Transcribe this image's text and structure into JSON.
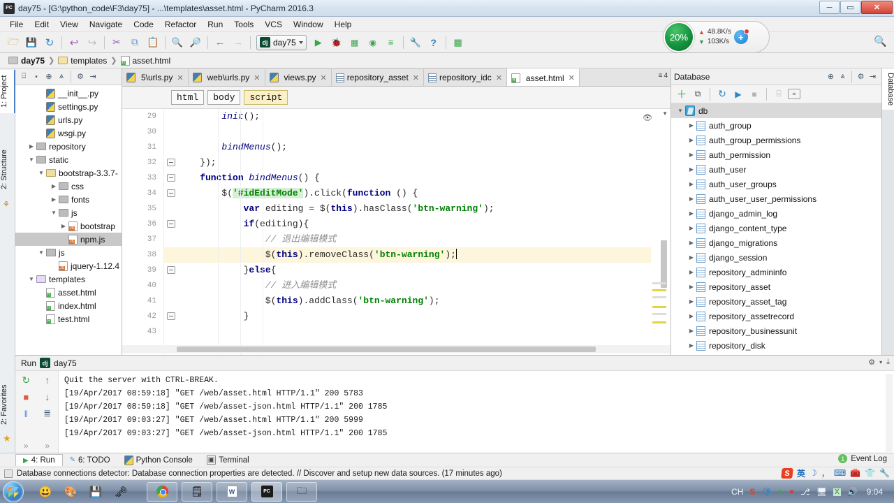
{
  "window": {
    "title": "day75 - [G:\\python_code\\F3\\day75] - ...\\templates\\asset.html - PyCharm 2016.3",
    "app_icon": "PC",
    "minimize": "─",
    "maximize": "▭",
    "close": "✕"
  },
  "menubar": [
    {
      "label": "File"
    },
    {
      "label": "Edit"
    },
    {
      "label": "View"
    },
    {
      "label": "Navigate"
    },
    {
      "label": "Code"
    },
    {
      "label": "Refactor"
    },
    {
      "label": "Run"
    },
    {
      "label": "Tools"
    },
    {
      "label": "VCS"
    },
    {
      "label": "Window"
    },
    {
      "label": "Help"
    }
  ],
  "toolbar": {
    "buttons": [
      {
        "name": "open-folder-icon",
        "glyph": "🗁",
        "color": "#d9a441"
      },
      {
        "name": "save-all-icon",
        "glyph": "💾",
        "color": "#5b7c99"
      },
      {
        "name": "sync-icon",
        "glyph": "↻",
        "color": "#2f86c5"
      },
      {
        "name": "undo-icon",
        "glyph": "↩",
        "color": "#9b59b6"
      },
      {
        "name": "redo-icon",
        "glyph": "↪",
        "color": "#b0b0b0"
      },
      {
        "name": "cut-icon",
        "glyph": "✂",
        "color": "#9b59b6"
      },
      {
        "name": "copy-icon",
        "glyph": "⧉",
        "color": "#5b9bd5"
      },
      {
        "name": "paste-icon",
        "glyph": "📋",
        "color": "#c9a227"
      },
      {
        "name": "find-icon",
        "glyph": "🔍",
        "color": "#4a7fb5"
      },
      {
        "name": "replace-icon",
        "glyph": "🔎",
        "color": "#4a7fb5"
      },
      {
        "name": "back-icon",
        "glyph": "←",
        "color": "#4a90d9"
      },
      {
        "name": "forward-icon",
        "glyph": "→",
        "color": "#b8ccdd"
      }
    ],
    "run_config": {
      "icon_label": "dj",
      "label": "day75"
    },
    "run_buttons": [
      {
        "name": "run-icon",
        "glyph": "▶",
        "color": "#3aa64c"
      },
      {
        "name": "debug-icon",
        "glyph": "🐞",
        "color": "#3aa64c"
      },
      {
        "name": "run-coverage-icon",
        "glyph": "▶",
        "color": "#3aa64c"
      },
      {
        "name": "profile-icon",
        "glyph": "▶",
        "color": "#3aa64c"
      },
      {
        "name": "attach-process-icon",
        "glyph": "≡",
        "color": "#3aa64c"
      }
    ],
    "tail_buttons": [
      {
        "name": "settings-icon",
        "glyph": "🔧",
        "color": "#6a7a88"
      },
      {
        "name": "help-icon",
        "glyph": "?",
        "color": "#2f7fc1"
      },
      {
        "name": "sdk-manager-icon",
        "glyph": "☷",
        "color": "#3aa64c"
      }
    ],
    "search_icon": "🔍"
  },
  "net_widget": {
    "cpu_percent": "20%",
    "upload": "48.8K/s",
    "download": "103K/s",
    "up_arrow": "▲",
    "down_arrow": "▼",
    "plus": "+"
  },
  "breadcrumb": [
    {
      "label": "day75",
      "icon": "folder-icon",
      "bold": true
    },
    {
      "label": "templates",
      "icon": "folder-open-icon",
      "bold": false
    },
    {
      "label": "asset.html",
      "icon": "html-file-icon",
      "bold": false
    }
  ],
  "left_strip": [
    {
      "label": "1: Project",
      "selected": true
    },
    {
      "label": "2: Structure",
      "selected": false
    },
    {
      "label": "2: Favorites",
      "selected": false
    }
  ],
  "project_tree": [
    {
      "label": "__init__.py",
      "indent": 3,
      "icon": "python-file-icon",
      "twisty": "",
      "selected": false
    },
    {
      "label": "settings.py",
      "indent": 3,
      "icon": "python-file-icon",
      "twisty": "",
      "selected": false
    },
    {
      "label": "urls.py",
      "indent": 3,
      "icon": "python-file-icon",
      "twisty": "",
      "selected": false
    },
    {
      "label": "wsgi.py",
      "indent": 3,
      "icon": "python-file-icon",
      "twisty": "",
      "selected": false
    },
    {
      "label": "repository",
      "indent": 2,
      "icon": "folder-icon",
      "twisty": "▶",
      "selected": false
    },
    {
      "label": "static",
      "indent": 2,
      "icon": "folder-icon",
      "twisty": "▼",
      "selected": false
    },
    {
      "label": "bootstrap-3.3.7-",
      "indent": 3,
      "icon": "folder-yellow-icon",
      "twisty": "▼",
      "selected": false
    },
    {
      "label": "css",
      "indent": 4,
      "icon": "folder-icon",
      "twisty": "▶",
      "selected": false
    },
    {
      "label": "fonts",
      "indent": 4,
      "icon": "folder-icon",
      "twisty": "▶",
      "selected": false
    },
    {
      "label": "js",
      "indent": 4,
      "icon": "folder-icon",
      "twisty": "▼",
      "selected": false
    },
    {
      "label": "bootstrap",
      "indent": 5,
      "icon": "js-file-icon",
      "twisty": "▶",
      "selected": false
    },
    {
      "label": "npm.js",
      "indent": 5,
      "icon": "js-file-icon",
      "twisty": "",
      "selected": true
    },
    {
      "label": "js",
      "indent": 3,
      "icon": "folder-icon",
      "twisty": "▼",
      "selected": false
    },
    {
      "label": "jquery-1.12.4",
      "indent": 4,
      "icon": "js-file-icon",
      "twisty": "",
      "selected": false
    },
    {
      "label": "templates",
      "indent": 2,
      "icon": "folder-purple-icon",
      "twisty": "▼",
      "selected": false
    },
    {
      "label": "asset.html",
      "indent": 3,
      "icon": "html-file-icon",
      "twisty": "",
      "selected": false
    },
    {
      "label": "index.html",
      "indent": 3,
      "icon": "html-file-icon",
      "twisty": "",
      "selected": false
    },
    {
      "label": "test.html",
      "indent": 3,
      "icon": "html-file-icon",
      "twisty": "",
      "selected": false
    }
  ],
  "project_toolbar_icons": [
    {
      "name": "collapse-selector-icon",
      "glyph": "⌸"
    },
    {
      "name": "target-icon",
      "glyph": "⊕"
    },
    {
      "name": "collapse-all-icon",
      "glyph": "⩓"
    },
    {
      "name": "settings-gear-icon",
      "glyph": "⚙"
    },
    {
      "name": "hide-panel-icon",
      "glyph": "⇥"
    }
  ],
  "editor_tabs": [
    {
      "label": "5\\urls.py",
      "icon": "python-file-icon",
      "active": false
    },
    {
      "label": "web\\urls.py",
      "icon": "python-file-icon",
      "active": false
    },
    {
      "label": "views.py",
      "icon": "python-file-icon",
      "active": false
    },
    {
      "label": "repository_asset",
      "icon": "table-icon",
      "active": false
    },
    {
      "label": "repository_idc",
      "icon": "table-icon",
      "active": false
    },
    {
      "label": "asset.html",
      "icon": "html-file-icon",
      "active": true
    }
  ],
  "tab_overflow": {
    "count": "4",
    "glyph": "≡"
  },
  "element_path": [
    {
      "label": "html",
      "selected": false
    },
    {
      "label": "body",
      "selected": false
    },
    {
      "label": "script",
      "selected": true
    }
  ],
  "editor": {
    "line_numbers": [
      "29",
      "30",
      "31",
      "32",
      "33",
      "34",
      "35",
      "36",
      "37",
      "38",
      "39",
      "40",
      "41",
      "42",
      "43"
    ],
    "highlighted_line_index": 9,
    "caret_line": "38",
    "preview_eye_icon": "👁",
    "lines": [
      {
        "num": "29",
        "text": "        init();"
      },
      {
        "num": "30",
        "text": ""
      },
      {
        "num": "31",
        "text": "        bindMenus();"
      },
      {
        "num": "32",
        "text": "    });"
      },
      {
        "num": "33",
        "text": "    function bindMenus() {"
      },
      {
        "num": "34",
        "text": "        $('#idEditMode').click(function () {"
      },
      {
        "num": "35",
        "text": "            var editing = $(this).hasClass('btn-warning');"
      },
      {
        "num": "36",
        "text": "            if(editing){"
      },
      {
        "num": "37",
        "text": "                // 退出编辑模式"
      },
      {
        "num": "38",
        "text": "                $(this).removeClass('btn-warning');"
      },
      {
        "num": "39",
        "text": "            }else{"
      },
      {
        "num": "40",
        "text": "                // 进入编辑模式"
      },
      {
        "num": "41",
        "text": "                $(this).addClass('btn-warning');"
      },
      {
        "num": "42",
        "text": "            }"
      },
      {
        "num": "43",
        "text": ""
      }
    ]
  },
  "database": {
    "title": "Database",
    "header_icons": [
      {
        "name": "refresh-icon",
        "glyph": "⊕"
      },
      {
        "name": "group-icon",
        "glyph": "⩓"
      },
      {
        "name": "settings-gear-icon",
        "glyph": "⚙"
      },
      {
        "name": "hide-panel-icon",
        "glyph": "⇥"
      }
    ],
    "toolbar_icons": [
      {
        "name": "add-datasource-icon",
        "glyph": "＋",
        "color": "#3aa64c"
      },
      {
        "name": "duplicate-icon",
        "glyph": "⧉",
        "color": "#555"
      },
      {
        "name": "synchronize-icon",
        "glyph": "↻",
        "color": "#2f86c5"
      },
      {
        "name": "run-sql-icon",
        "glyph": "▶",
        "color": "#2f86c5"
      },
      {
        "name": "stop-icon",
        "glyph": "■",
        "color": "#aaa"
      },
      {
        "name": "table-editor-icon",
        "glyph": "⌸",
        "color": "#aaa"
      },
      {
        "name": "sql-console-icon",
        "glyph": "⌗",
        "color": "#3d566e"
      }
    ],
    "root": {
      "label": "db",
      "twisty": "▼",
      "icon": "database-icon"
    },
    "tables": [
      "auth_group",
      "auth_group_permissions",
      "auth_permission",
      "auth_user",
      "auth_user_groups",
      "auth_user_user_permissions",
      "django_admin_log",
      "django_content_type",
      "django_migrations",
      "django_session",
      "repository_admininfo",
      "repository_asset",
      "repository_asset_tag",
      "repository_assetrecord",
      "repository_businessunit",
      "repository_disk"
    ],
    "table_twisty": "▶",
    "side_label": "Database"
  },
  "run_window": {
    "title": "Run",
    "config_icon": "dj",
    "config_label": "day75",
    "header_icons": [
      {
        "name": "settings-gear-icon",
        "glyph": "⚙"
      },
      {
        "name": "hide-panel-icon",
        "glyph": "⤓"
      }
    ],
    "side_icons_col1": [
      {
        "name": "rerun-icon",
        "glyph": "↻",
        "color": "#3aa64c"
      },
      {
        "name": "stop-icon",
        "glyph": "■",
        "color": "#e05b4a"
      },
      {
        "name": "pause-icon",
        "glyph": "‖",
        "color": "#4a90d9"
      },
      {
        "name": "expand-more-icon",
        "glyph": "»",
        "color": "#888"
      }
    ],
    "side_icons_col2": [
      {
        "name": "up-stack-icon",
        "glyph": "↑",
        "color": "#2f86c5"
      },
      {
        "name": "down-stack-icon",
        "glyph": "↓",
        "color": "#2f86c5"
      },
      {
        "name": "soft-wrap-icon",
        "glyph": "≣",
        "color": "#3d566e"
      },
      {
        "name": "expand-more-icon",
        "glyph": "»",
        "color": "#888"
      }
    ],
    "console_lines": [
      "Quit the server with CTRL-BREAK.",
      "[19/Apr/2017 08:59:18] \"GET /web/asset.html HTTP/1.1\" 200 5783",
      "[19/Apr/2017 08:59:18] \"GET /web/asset-json.html HTTP/1.1\" 200 1785",
      "[19/Apr/2017 09:03:27] \"GET /web/asset.html HTTP/1.1\" 200 5999",
      "[19/Apr/2017 09:03:27] \"GET /web/asset-json.html HTTP/1.1\" 200 1785"
    ]
  },
  "bottom_tabs": [
    {
      "label": "4: Run",
      "icon": "run-icon",
      "selected": true
    },
    {
      "label": "6: TODO",
      "icon": "todo-icon",
      "selected": false
    },
    {
      "label": "Python Console",
      "icon": "python-icon",
      "selected": false
    },
    {
      "label": "Terminal",
      "icon": "terminal-icon",
      "selected": false
    }
  ],
  "event_log": {
    "badge": "1",
    "label": "Event Log"
  },
  "statusbar": {
    "message": "Database connections detector: Database connection properties are detected. // Discover and setup new data sources. (17 minutes ago)",
    "tray": [
      {
        "name": "sogou-input-icon",
        "glyph": "S"
      },
      {
        "name": "chinese-mode-icon",
        "glyph": "英"
      },
      {
        "name": "moon-icon",
        "glyph": "☽"
      },
      {
        "name": "punctuation-icon",
        "glyph": "，"
      },
      {
        "name": "keyboard-icon",
        "glyph": "⌨"
      },
      {
        "name": "toolbox-icon",
        "glyph": "🧰"
      },
      {
        "name": "skin-icon",
        "glyph": "👕"
      },
      {
        "name": "wrench-icon",
        "glyph": "🔧"
      }
    ]
  },
  "taskbar": {
    "quick_launch": [
      {
        "name": "qq-icon",
        "glyph": "😃"
      },
      {
        "name": "paint-icon",
        "glyph": "🎨"
      },
      {
        "name": "save-icon",
        "glyph": "💾"
      },
      {
        "name": "key-icon",
        "glyph": "🗝"
      }
    ],
    "tasks": [
      {
        "name": "taskbar-chrome",
        "icon": "chrome-icon",
        "active": false
      },
      {
        "name": "taskbar-notepad",
        "icon": "notepad-icon",
        "active": false
      },
      {
        "name": "taskbar-word",
        "icon": "word-icon",
        "active": false
      },
      {
        "name": "taskbar-pycharm",
        "icon": "pycharm-icon",
        "active": true
      },
      {
        "name": "taskbar-explorer",
        "icon": "explorer-icon",
        "active": false
      }
    ],
    "tray": [
      {
        "name": "show-desktop-icon",
        "glyph": "CH"
      },
      {
        "name": "sogou-tray-icon",
        "glyph": "S"
      },
      {
        "name": "shield-icon",
        "glyph": "🛡"
      },
      {
        "name": "compass-icon",
        "glyph": "●"
      },
      {
        "name": "circle-red-icon",
        "glyph": "●"
      },
      {
        "name": "share-icon",
        "glyph": "⎇"
      },
      {
        "name": "network-icon",
        "glyph": "🖥"
      },
      {
        "name": "excel-tray-icon",
        "glyph": "X"
      },
      {
        "name": "volume-icon",
        "glyph": "🔊"
      }
    ],
    "clock": "9:04"
  }
}
